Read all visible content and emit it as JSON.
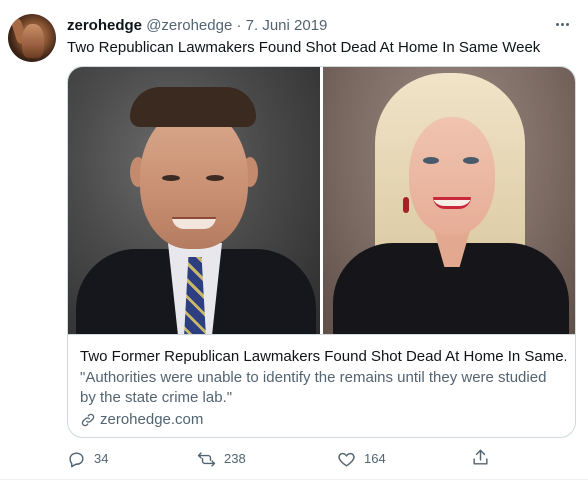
{
  "tweet": {
    "display_name": "zerohedge",
    "handle": "@zerohedge",
    "separator": "·",
    "date": "7. Juni 2019",
    "text": "Two Republican Lawmakers Found Shot Dead At Home In Same Week"
  },
  "card": {
    "title": "Two Former Republican Lawmakers Found Shot Dead At Home In Same...",
    "description": "\"Authorities were unable to identify the remains until they were studied by the state crime lab.\"",
    "domain": "zerohedge.com"
  },
  "actions": {
    "reply_count": "34",
    "retweet_count": "238",
    "like_count": "164"
  },
  "icons": [
    "more-icon",
    "link-icon",
    "reply-icon",
    "retweet-icon",
    "like-icon",
    "share-icon"
  ],
  "colors": {
    "text_primary": "#0f1419",
    "text_secondary": "#536471",
    "border": "#cfd9de"
  }
}
